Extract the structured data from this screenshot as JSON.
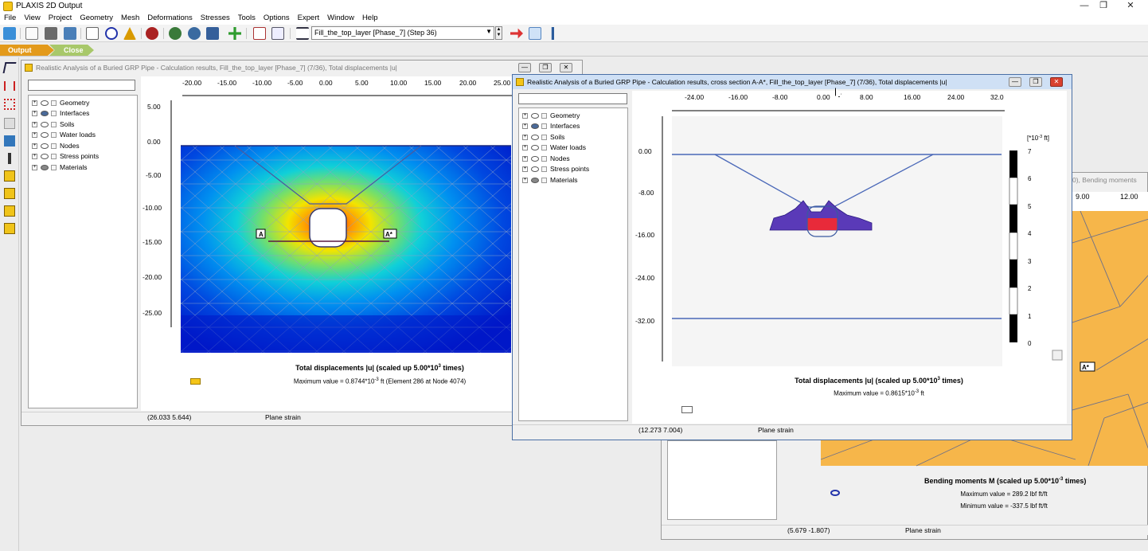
{
  "app": {
    "title": "PLAXIS 2D Output"
  },
  "menu": [
    "File",
    "View",
    "Project",
    "Geometry",
    "Mesh",
    "Deformations",
    "Stresses",
    "Tools",
    "Options",
    "Expert",
    "Window",
    "Help"
  ],
  "toolbar": {
    "step_select": "Fill_the_top_layer [Phase_7] (Step 36)"
  },
  "tabs": {
    "output": "Output",
    "close": "Close"
  },
  "tree_items": [
    "Geometry",
    "Interfaces",
    "Soils",
    "Water loads",
    "Nodes",
    "Stress points",
    "Materials"
  ],
  "win_main": {
    "title": "Realistic Analysis of a Buried GRP Pipe - Calculation results, Fill_the_top_layer [Phase_7] (7/36), Total displacements |u|",
    "x_ticks": [
      "-20.00",
      "-15.00",
      "-10.00",
      "-5.00",
      "0.00",
      "5.00",
      "10.00",
      "15.00",
      "20.00",
      "25.00"
    ],
    "y_ticks": [
      "5.00",
      "0.00",
      "-5.00",
      "-10.00",
      "-15.00",
      "-20.00",
      "-25.00"
    ],
    "label_a": "A",
    "label_a_star": "A*",
    "caption": "Total displacements |u| (scaled up 5.00*10",
    "caption_exp": "3",
    "caption_tail": " times)",
    "max_value": "Maximum value = 0.8744*10",
    "max_exp": "-3",
    "max_tail": " ft (Element 286 at Node 4074)",
    "status_coords": "(26.033 5.644)",
    "status_mode": "Plane strain"
  },
  "win_cross": {
    "title": "Realistic Analysis of a Buried GRP Pipe - Calculation results, cross section A-A*, Fill_the_top_layer [Phase_7] (7/36), Total displacements |u|",
    "x_ticks": [
      "-24.00",
      "-16.00",
      "-8.00",
      "0.00",
      "8.00",
      "16.00",
      "24.00",
      "32.0"
    ],
    "y_ticks": [
      "0.00",
      "-8.00",
      "-16.00",
      "-24.00",
      "-32.00"
    ],
    "unit_label": "[*10",
    "unit_exp": "-3",
    "unit_tail": " ft]",
    "legend_values": [
      "7",
      "6",
      "5",
      "4",
      "3",
      "2",
      "1",
      "0"
    ],
    "caption": "Total displacements |u| (scaled up 5.00*10",
    "caption_exp": "3",
    "caption_tail": " times)",
    "max_value": "Maximum value = 0.8615*10",
    "max_exp": "-3",
    "max_tail": " ft",
    "status_coords": "(12.273 7.004)",
    "status_mode": "Plane strain"
  },
  "win_moment": {
    "title_fragment": "0), Bending moments",
    "x_ticks": [
      "9.00",
      "12.00"
    ],
    "label_a_star": "A*",
    "caption": "Bending moments M (scaled up 5.00*10",
    "caption_exp": "-3",
    "caption_tail": " times)",
    "max_value": "Maximum value = 289.2 lbf ft/ft",
    "min_value": "Minimum value = -337.5 lbf ft/ft",
    "status_coords": "(5.679 -1.807)",
    "status_mode": "Plane strain"
  }
}
